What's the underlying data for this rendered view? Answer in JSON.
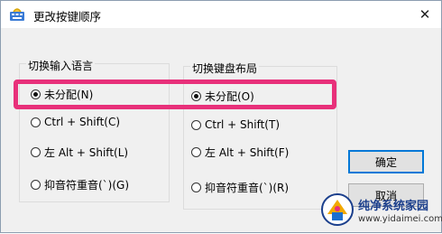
{
  "window": {
    "title": "更改按键顺序",
    "close_glyph": "✕"
  },
  "left_group": {
    "label": "切换输入语言",
    "options": [
      {
        "label": "未分配(N)",
        "checked": true
      },
      {
        "label": "Ctrl + Shift(C)",
        "checked": false
      },
      {
        "label": "左 Alt + Shift(L)",
        "checked": false
      },
      {
        "label": "抑音符重音(`)(G)",
        "checked": false
      }
    ]
  },
  "right_group": {
    "label": "切换键盘布局",
    "options": [
      {
        "label": "未分配(O)",
        "checked": true
      },
      {
        "label": "Ctrl + Shift(T)",
        "checked": false
      },
      {
        "label": "左 Alt + Shift(F)",
        "checked": false
      },
      {
        "label": "抑音符重音(`)(R)",
        "checked": false
      }
    ]
  },
  "buttons": {
    "ok": "确定",
    "cancel": "取消"
  },
  "highlight_color": "#e8307a",
  "watermark": {
    "title": "纯净系统家园",
    "url": "www.yidaimei.com"
  }
}
